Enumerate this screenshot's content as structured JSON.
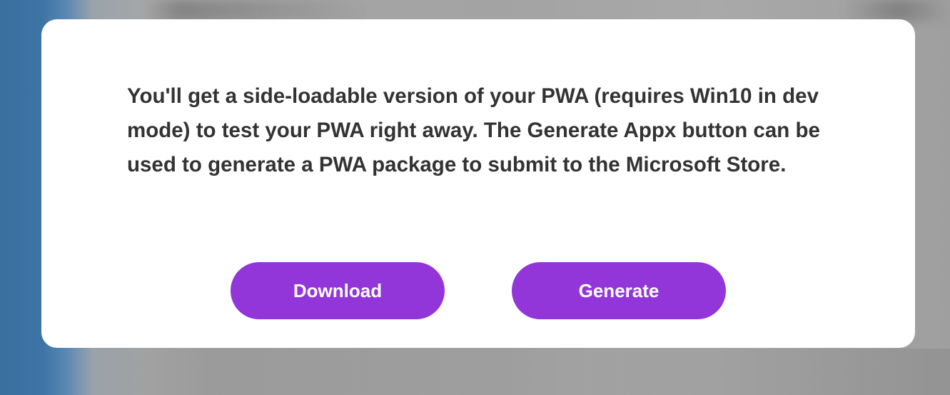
{
  "dialog": {
    "message": "You'll get a side-loadable version of your PWA (requires Win10 in dev mode) to test your PWA right away. The Generate Appx button can be used to generate a PWA package to submit to the Microsoft Store.",
    "buttons": {
      "download_label": "Download",
      "generate_label": "Generate"
    }
  },
  "colors": {
    "button_background": "#9236d9",
    "button_text": "#ffffff",
    "message_text": "#333333",
    "dialog_background": "#ffffff"
  }
}
